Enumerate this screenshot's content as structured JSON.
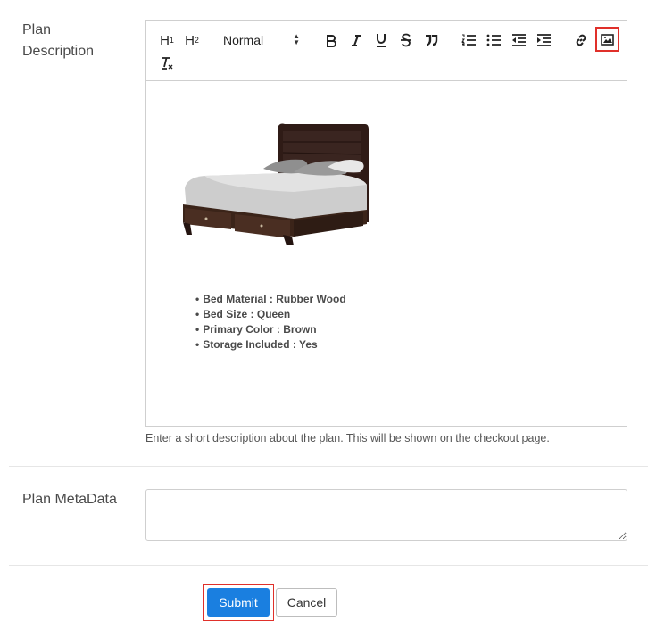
{
  "form": {
    "description_label": "Plan Description",
    "metadata_label": "Plan MetaData",
    "help_text": "Enter a short description about the plan. This will be shown on the checkout page.",
    "metadata_value": ""
  },
  "toolbar": {
    "h1_label": "H",
    "h1_sub": "1",
    "h2_label": "H",
    "h2_sub": "2",
    "format_select": "Normal",
    "format_options": [
      "Normal"
    ],
    "highlighted_button": "image-icon"
  },
  "editor": {
    "image_subject": "dark wood bed with storage drawers",
    "bullets": [
      "Bed Material : Rubber Wood",
      "Bed Size : Queen",
      "Primary Color : Brown",
      "Storage Included : Yes"
    ]
  },
  "buttons": {
    "submit_label": "Submit",
    "cancel_label": "Cancel"
  },
  "colors": {
    "primary": "#1a7fe0",
    "highlight_border": "#e0302a",
    "border": "#cfcfcf"
  }
}
